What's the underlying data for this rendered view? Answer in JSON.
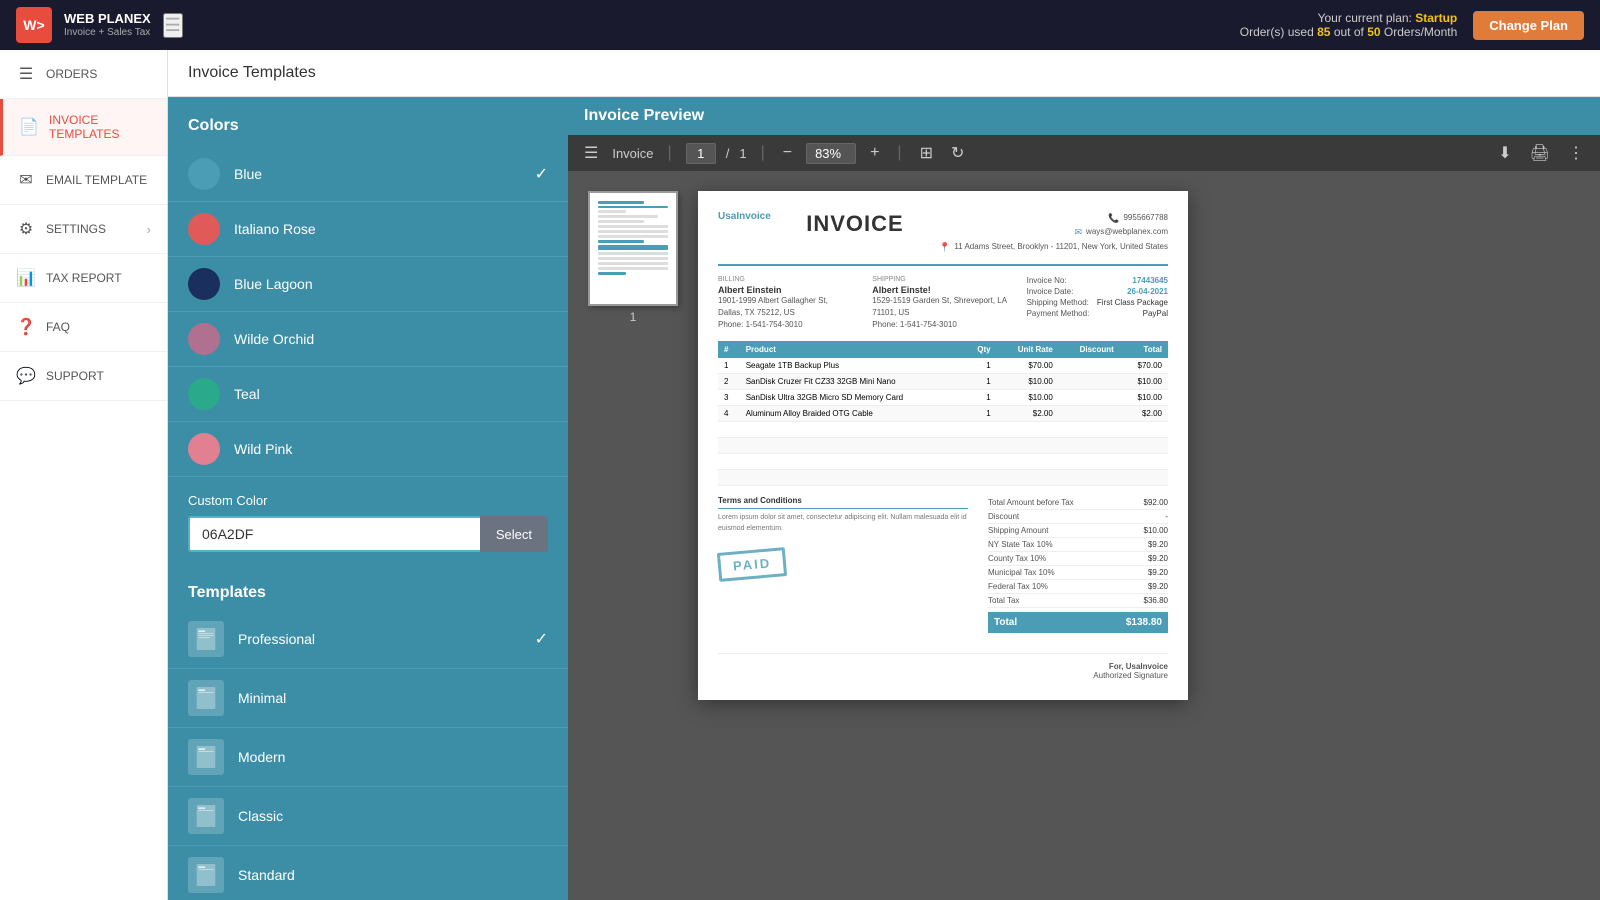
{
  "topbar": {
    "logo_text": "WEB PLANEX",
    "logo_sub": "Invoice + Sales Tax",
    "plan_label": "Your current plan:",
    "plan_name": "Startup",
    "orders_label": "Order(s) used",
    "orders_used": "85",
    "orders_of": "out of",
    "orders_limit": "50",
    "orders_unit": "Orders/Month",
    "change_plan_label": "Change Plan"
  },
  "sidebar": {
    "items": [
      {
        "id": "orders",
        "label": "ORDERS",
        "icon": "☰",
        "active": false
      },
      {
        "id": "invoice-templates",
        "label": "INVOICE TEMPLATES",
        "icon": "📄",
        "active": true
      },
      {
        "id": "email-template",
        "label": "EMAIL TEMPLATE",
        "icon": "✉",
        "active": false
      },
      {
        "id": "settings",
        "label": "SETTINGS",
        "icon": "⚙",
        "active": false,
        "arrow": true
      },
      {
        "id": "tax-report",
        "label": "TAX REPORT",
        "icon": "📊",
        "active": false
      },
      {
        "id": "faq",
        "label": "FAQ",
        "icon": "❓",
        "active": false
      },
      {
        "id": "support",
        "label": "SUPPORT",
        "icon": "💬",
        "active": false
      }
    ]
  },
  "page_header": {
    "title": "Invoice Templates"
  },
  "left_panel": {
    "colors_title": "Colors",
    "colors": [
      {
        "id": "blue",
        "label": "Blue",
        "hex": "#4a9db5",
        "checked": true
      },
      {
        "id": "italiano-rose",
        "label": "Italiano Rose",
        "hex": "#e05a5a",
        "checked": false
      },
      {
        "id": "blue-lagoon",
        "label": "Blue Lagoon",
        "hex": "#1a2f5e",
        "checked": false
      },
      {
        "id": "wilde-orchid",
        "label": "Wilde Orchid",
        "hex": "#b07090",
        "checked": false
      },
      {
        "id": "teal",
        "label": "Teal",
        "hex": "#2aaa8a",
        "checked": false
      },
      {
        "id": "wild-pink",
        "label": "Wild Pink",
        "hex": "#e08090",
        "checked": false
      }
    ],
    "custom_color_label": "Custom Color",
    "custom_color_value": "06A2DF",
    "select_btn_label": "Select",
    "templates_title": "Templates",
    "templates": [
      {
        "id": "professional",
        "label": "Professional",
        "checked": true
      },
      {
        "id": "minimal",
        "label": "Minimal",
        "checked": false
      },
      {
        "id": "modern",
        "label": "Modern",
        "checked": false
      },
      {
        "id": "classic",
        "label": "Classic",
        "checked": false
      },
      {
        "id": "standard",
        "label": "Standard",
        "checked": false
      }
    ]
  },
  "right_panel": {
    "preview_title": "Invoice Preview",
    "toolbar": {
      "menu_icon": "☰",
      "invoice_label": "Invoice",
      "page_current": "1",
      "page_total": "1",
      "zoom_out": "−",
      "zoom_in": "+",
      "zoom_pct": "83%",
      "fit_icon": "⊞",
      "rotate_icon": "↻",
      "download_icon": "⬇",
      "print_icon": "🖨",
      "more_icon": "⋮"
    },
    "thumbnail_page": "1",
    "invoice": {
      "brand": "UsaInvoice",
      "title": "INVOICE",
      "phone": "9955667788",
      "email": "ways@webplanex.com",
      "address": "11 Adams Street, Brooklyn - 11201, New York, United States",
      "billing_label": "Billing",
      "billing_name": "Albert Einstein",
      "billing_addr": "1901-1999 Albert Gallagher St, Dallas, TX 75212, US",
      "billing_phone": "Phone: 1-541-754-3010",
      "shipping_label": "Shipping",
      "shipping_name": "Albert Einste!",
      "shipping_addr": "1529-1519 Garden St, Shreveport, LA 71101, US",
      "shipping_phone": "Phone: 1-541-754-3010",
      "invoice_no_label": "Invoice No:",
      "invoice_no": "17443645",
      "invoice_date_label": "Invoice Date:",
      "invoice_date": "26-04-2021",
      "shipping_method_label": "Shipping Method:",
      "shipping_method": "First Class Package",
      "payment_method_label": "Payment Method:",
      "payment_method": "PayPal",
      "table_headers": [
        "#",
        "Product",
        "Qty",
        "Unit Rate",
        "Discount",
        "Total"
      ],
      "table_rows": [
        {
          "num": "1",
          "product": "Seagate 1TB Backup Plus",
          "qty": "1",
          "rate": "$70.00",
          "discount": "",
          "total": "$70.00"
        },
        {
          "num": "2",
          "product": "SanDisk Cruzer Fit CZ33 32GB Mini Nano",
          "qty": "1",
          "rate": "$10.00",
          "discount": "",
          "total": "$10.00"
        },
        {
          "num": "3",
          "product": "SanDisk Ultra 32GB Micro SD Memory Card",
          "qty": "1",
          "rate": "$10.00",
          "discount": "",
          "total": "$10.00"
        },
        {
          "num": "4",
          "product": "Aluminum Alloy Braided OTG Cable",
          "qty": "1",
          "rate": "$2.00",
          "discount": "",
          "total": "$2.00"
        }
      ],
      "terms_label": "Terms and Conditions",
      "terms_text": "Lorem ipsum dolor sit amet, consectetur adipiscing elit. Nullam malesuada elit id euismod elementum.",
      "paid_stamp": "PAID",
      "totals": [
        {
          "label": "Total Amount before Tax",
          "value": "$92.00"
        },
        {
          "label": "Discount",
          "value": "-"
        },
        {
          "label": "Shipping Amount",
          "value": "$10.00"
        },
        {
          "label": "NY State Tax 10%",
          "value": "$9.20"
        },
        {
          "label": "County Tax 10%",
          "value": "$9.20"
        },
        {
          "label": "Municipal Tax 10%",
          "value": "$9.20"
        },
        {
          "label": "Federal Tax 10%",
          "value": "$9.20"
        },
        {
          "label": "Total Tax",
          "value": "$36.80"
        }
      ],
      "grand_total_label": "Total",
      "grand_total_value": "$138.80",
      "footer_for": "For, UsaInvoice",
      "footer_sig": "Authorized Signature"
    }
  }
}
